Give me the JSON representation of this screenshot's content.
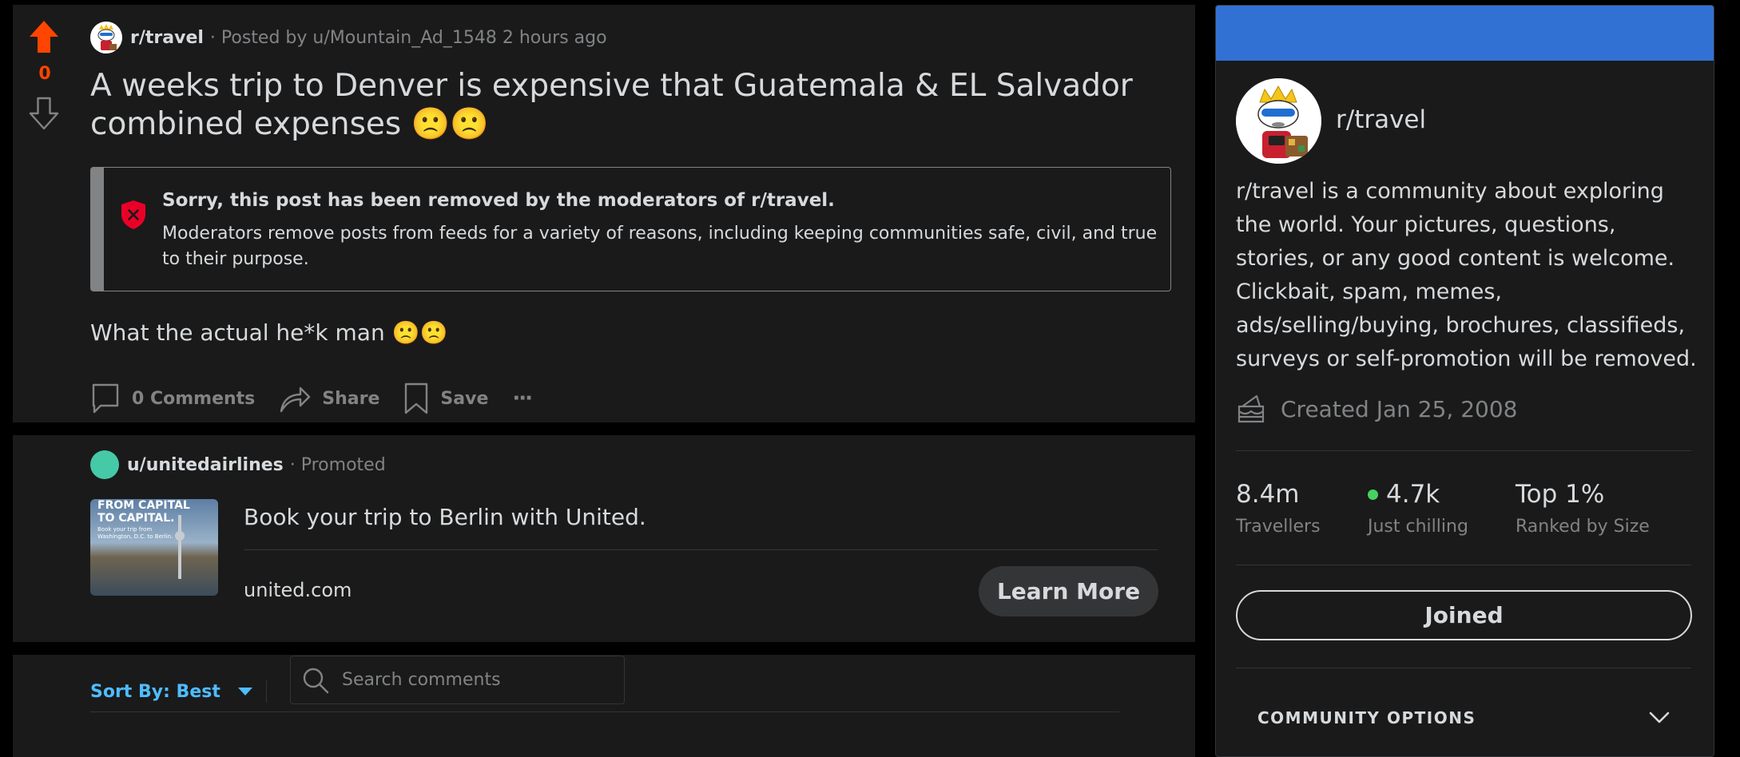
{
  "post": {
    "vote_count": "0",
    "subreddit": "r/travel",
    "posted_by": "· Posted by u/Mountain_Ad_1548 2 hours ago",
    "title": "A weeks trip to Denver is expensive that Guatemala & EL Salvador combined expenses 🙁🙁",
    "removed_title": "Sorry, this post has been removed by the moderators of r/travel.",
    "removed_body": "Moderators remove posts from feeds for a variety of reasons, including keeping communities safe, civil, and true to their purpose.",
    "body": "What the actual he*k man 🙁🙁",
    "actions": {
      "comments_label": "0 Comments",
      "share_label": "Share",
      "save_label": "Save",
      "more_label": "···"
    }
  },
  "promoted": {
    "user": "u/unitedairlines",
    "tag": "· Promoted",
    "thumb_headline": "FROM CAPITAL TO CAPITAL.",
    "thumb_sub": "Book your trip from Washington, D.C. to Berlin.",
    "headline": "Book your trip to Berlin with United.",
    "domain": "united.com",
    "cta_label": "Learn More"
  },
  "comments": {
    "sort_label": "Sort By: Best",
    "search_placeholder": "Search comments"
  },
  "sidebar": {
    "name": "r/travel",
    "description": "r/travel is a community about exploring the world. Your pictures, questions, stories, or any good content is welcome. Clickbait, spam, memes, ads/selling/buying, brochures, classifieds, surveys or self-promotion will be removed.",
    "created": "Created Jan 25, 2008",
    "stats": [
      {
        "value": "8.4m",
        "label": "Travellers"
      },
      {
        "value": "4.7k",
        "label": "Just chilling"
      },
      {
        "value": "Top 1%",
        "label": "Ranked by Size"
      }
    ],
    "joined_label": "Joined",
    "community_options_label": "COMMUNITY OPTIONS"
  },
  "colors": {
    "upvote_active": "#ff4500",
    "link_blue": "#4fbcff",
    "banner": "#3271d4",
    "online_dot": "#46d160"
  }
}
